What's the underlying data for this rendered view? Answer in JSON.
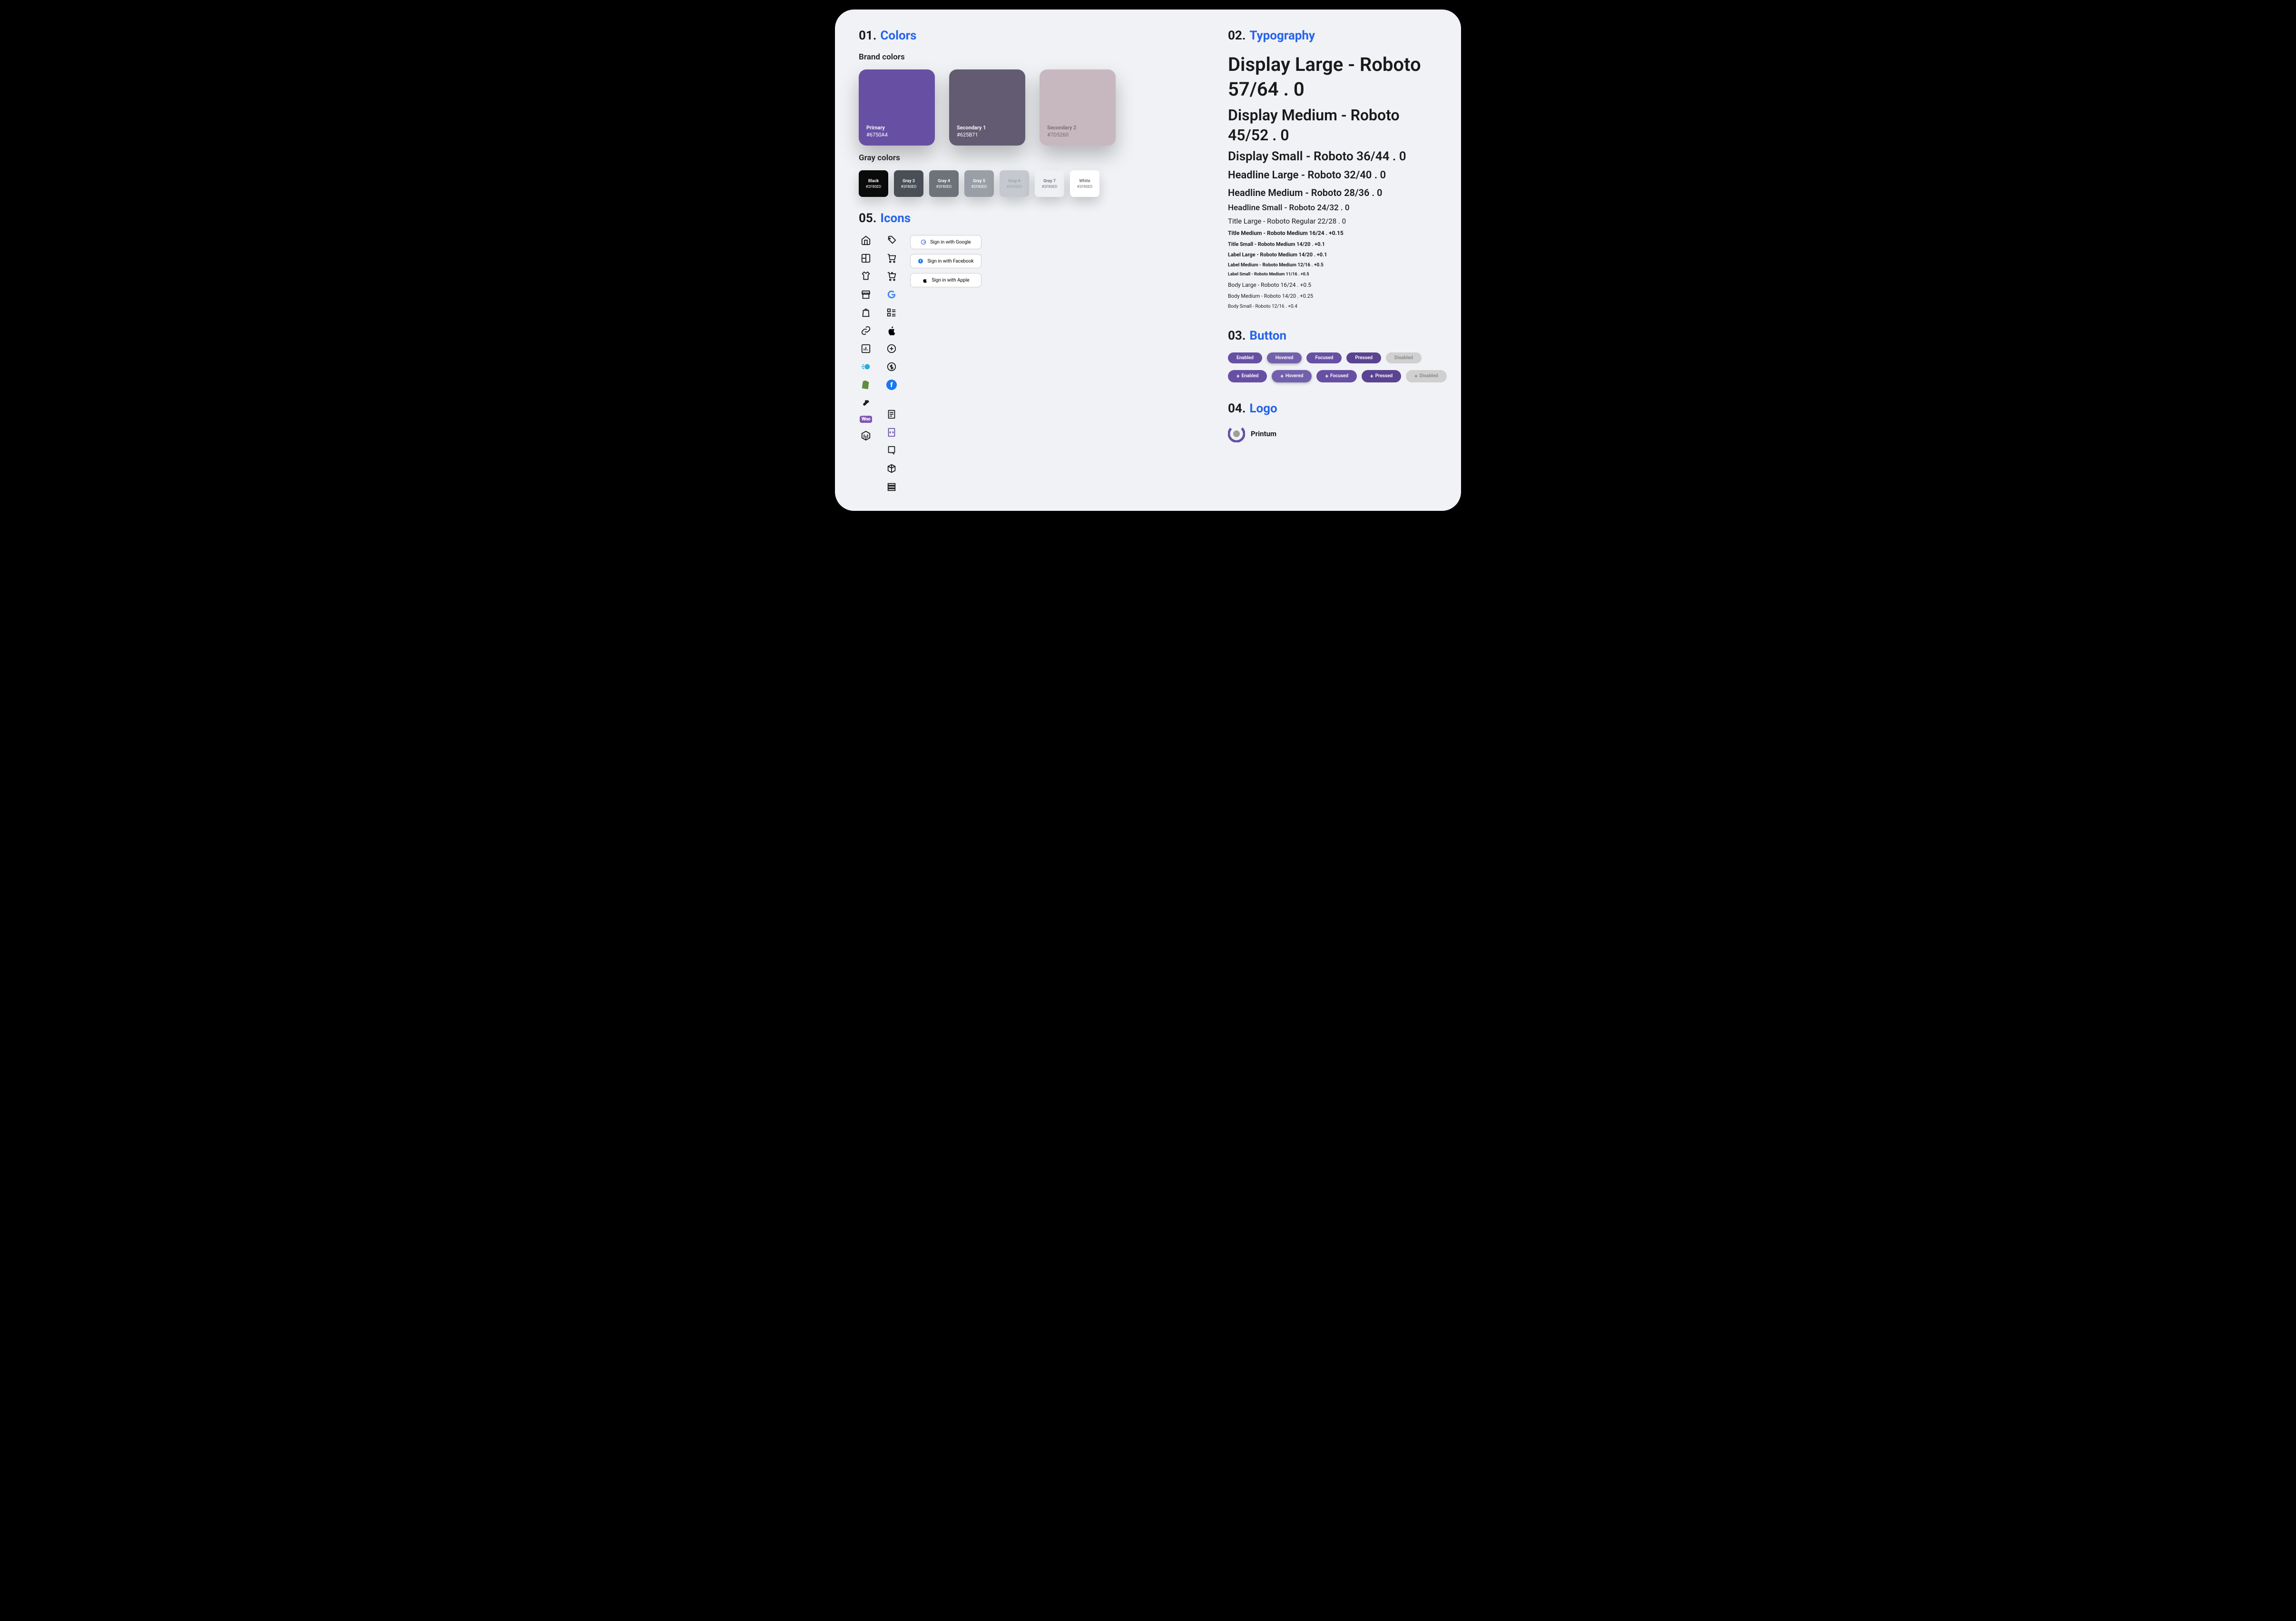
{
  "sections": {
    "colors": {
      "num": "01.",
      "title": "Colors"
    },
    "typography": {
      "num": "02.",
      "title": "Typography"
    },
    "button": {
      "num": "03.",
      "title": "Button"
    },
    "logo": {
      "num": "04.",
      "title": "Logo"
    },
    "icons": {
      "num": "05.",
      "title": "Icons"
    }
  },
  "subheads": {
    "brand": "Brand colors",
    "gray": "Gray colors"
  },
  "brand": [
    {
      "name": "Primary",
      "hex": "#6750A4",
      "bg": "#6750A4",
      "fg": "#ffffff"
    },
    {
      "name": "Secondary 1",
      "hex": "#625B71",
      "bg": "#625B71",
      "fg": "#ffffff"
    },
    {
      "name": "Secondary 2",
      "hex": "#7D5260",
      "bg": "#C6B8BE",
      "fg": "#7a6a70"
    }
  ],
  "grays": [
    {
      "name": "Black",
      "hex": "#2F80ED",
      "bg": "#0a0a0a",
      "fg": "#ffffff"
    },
    {
      "name": "Gray 3",
      "hex": "#2F80ED",
      "bg": "#4a4f57",
      "fg": "#ffffff"
    },
    {
      "name": "Gray 4",
      "hex": "#2F80ED",
      "bg": "#6e737b",
      "fg": "#ffffff"
    },
    {
      "name": "Gray 5",
      "hex": "#2F80ED",
      "bg": "#9a9fa7",
      "fg": "#ffffff"
    },
    {
      "name": "Gray 6",
      "hex": "#2F80ED",
      "bg": "#c5c9cf",
      "fg": "#9aa0a8"
    },
    {
      "name": "Gray 7",
      "hex": "#2F80ED",
      "bg": "#eef0f3",
      "fg": "#6b6f76"
    },
    {
      "name": "White",
      "hex": "#2F80ED",
      "bg": "#ffffff",
      "fg": "#6b6f76"
    }
  ],
  "typography": [
    {
      "cls": "t-dl",
      "text": "Display Large - Roboto 57/64 . 0"
    },
    {
      "cls": "t-dm",
      "text": "Display Medium - Roboto 45/52 .  0"
    },
    {
      "cls": "t-ds",
      "text": "Display Small - Roboto 36/44 . 0"
    },
    {
      "cls": "t-hl",
      "text": "Headline Large - Roboto 32/40 . 0"
    },
    {
      "cls": "t-hm",
      "text": "Headline Medium - Roboto 28/36 . 0"
    },
    {
      "cls": "t-hs",
      "text": "Headline Small - Roboto 24/32 . 0"
    },
    {
      "cls": "t-tl",
      "text": "Title Large - Roboto Regular 22/28 . 0"
    },
    {
      "cls": "t-tm",
      "text": "Title Medium - Roboto Medium 16/24 . +0.15"
    },
    {
      "cls": "t-ts",
      "text": "Title Small - Roboto Medium 14/20 . +0.1"
    },
    {
      "cls": "t-ll",
      "text": "Label Large - Roboto Medium 14/20 . +0.1"
    },
    {
      "cls": "t-lm",
      "text": "Label Medium - Roboto Medium 12/16 . +0.5"
    },
    {
      "cls": "t-ls",
      "text": "Label Small - Roboto Medium 11/16 . +0.5"
    },
    {
      "cls": "t-bl",
      "text": "Body Large - Roboto 16/24 . +0.5"
    },
    {
      "cls": "t-bm",
      "text": "Body Medium - Roboto 14/20 . +0.25"
    },
    {
      "cls": "t-bs",
      "text": "Body Small - Roboto 12/16 . +0.4"
    }
  ],
  "buttons_row1": [
    {
      "state": "enabled",
      "label": "Enabled"
    },
    {
      "state": "hovered",
      "label": "Hovered"
    },
    {
      "state": "focused",
      "label": "Focused"
    },
    {
      "state": "pressed",
      "label": "Pressed"
    },
    {
      "state": "disabled",
      "label": "Disabled"
    }
  ],
  "buttons_row2": [
    {
      "state": "enabled",
      "label": "Enabled"
    },
    {
      "state": "hovered",
      "label": "Hovered"
    },
    {
      "state": "focused",
      "label": "Focused"
    },
    {
      "state": "pressed",
      "label": "Pressed"
    },
    {
      "state": "disabled",
      "label": "Disabled"
    }
  ],
  "logo": {
    "name": "Printum"
  },
  "signin": {
    "google": "Sign in with Google",
    "facebook": "Sign in with Facebook",
    "apple": "Sign in with Apple"
  },
  "icons_col1": [
    "home",
    "dashboard",
    "shirt",
    "store",
    "bag",
    "link",
    "chart",
    "motion",
    "shopify",
    "squarespace",
    "woo",
    "magento"
  ],
  "icons_col2": [
    "tags",
    "cart",
    "cart-add",
    "google",
    "form",
    "apple",
    "plus-circle",
    "dollar",
    "facebook"
  ],
  "icons_col3": [
    "file",
    "file-code",
    "file-edit",
    "cube",
    "stack"
  ]
}
